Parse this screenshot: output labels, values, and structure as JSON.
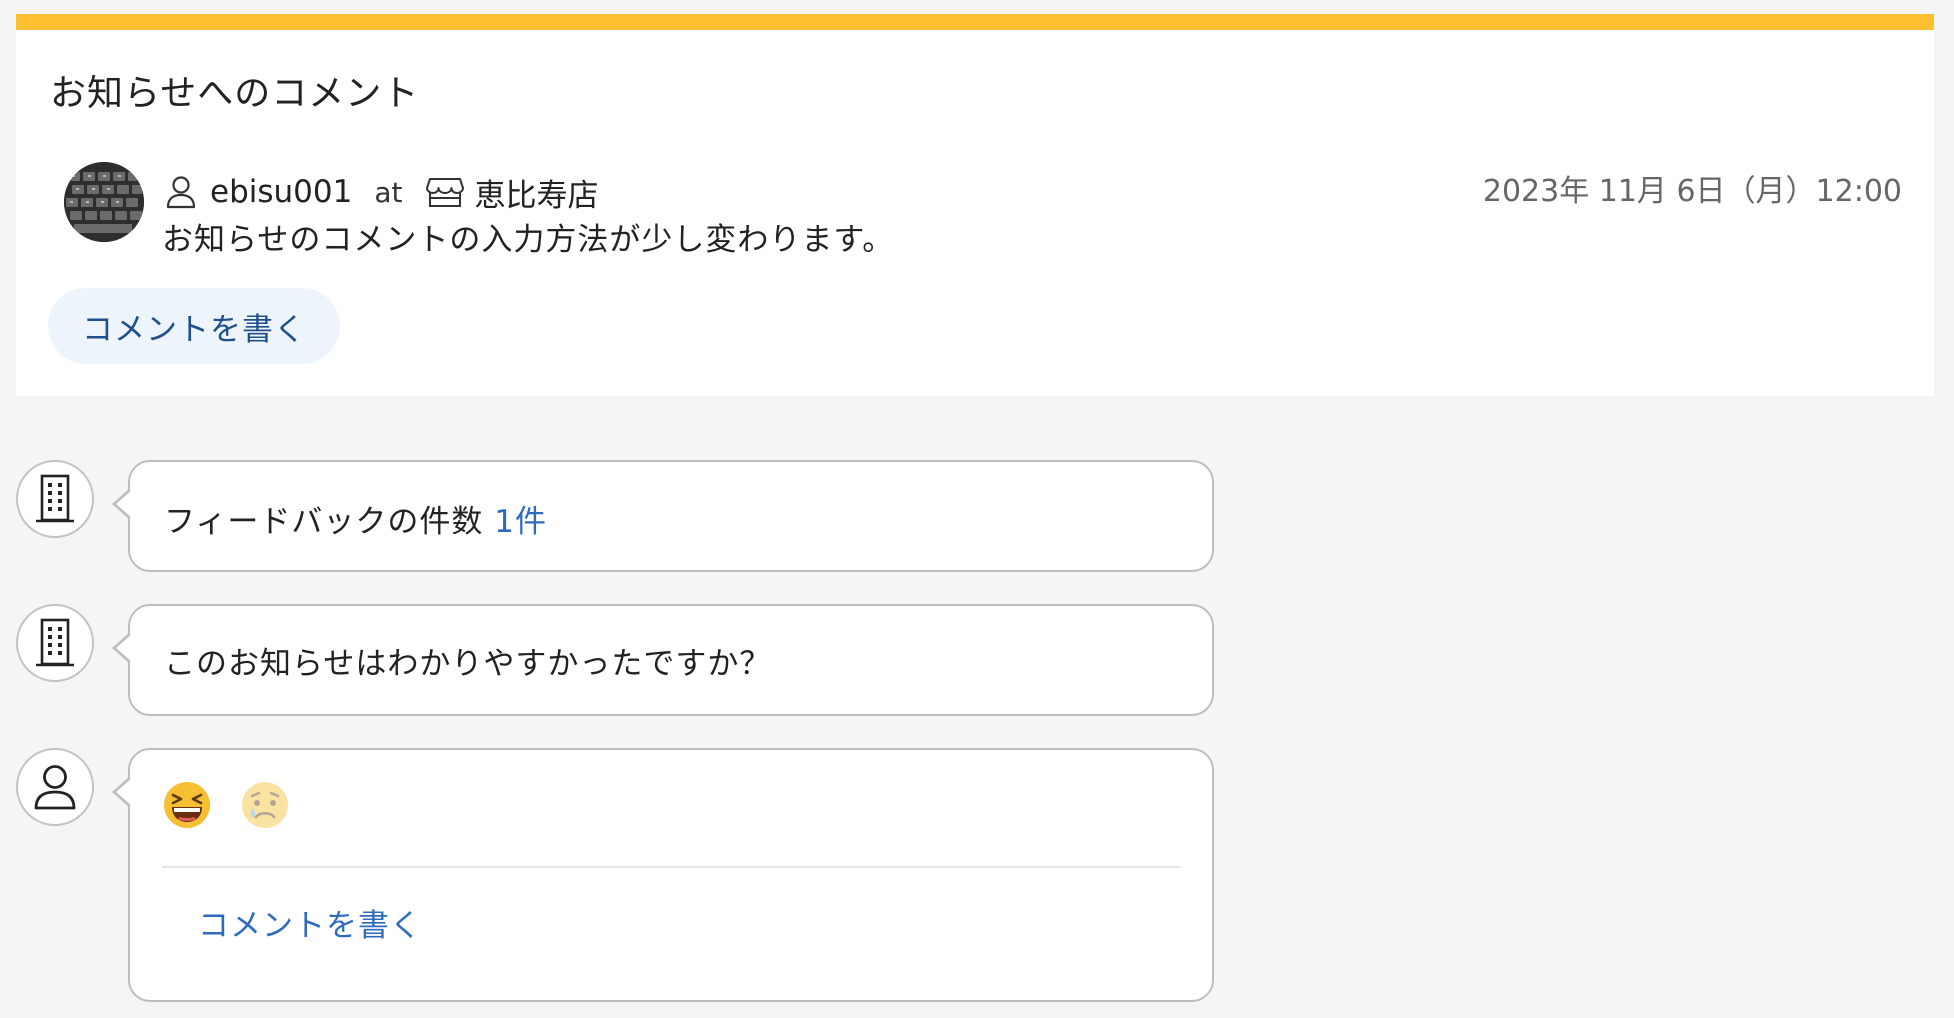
{
  "card": {
    "title": "お知らせへのコメント",
    "accent_color": "#fcbf2f"
  },
  "post": {
    "avatar_icon": "keyboard-photo-avatar",
    "username": "ebisu001",
    "at": "at",
    "store": "恵比寿店",
    "datetime": "2023年 11月 6日（月）12:00",
    "body": "お知らせのコメントの入力方法が少し変わります。",
    "comment_button_label": "コメントを書く"
  },
  "feed": {
    "feedback_prefix": "フィードバックの件数",
    "feedback_count": "1件",
    "question": "このお知らせはわかりやすかったですか？",
    "reactions": [
      {
        "icon": "laughing-emoji-icon"
      },
      {
        "icon": "sad-emoji-icon"
      }
    ],
    "comment_link_label": "コメントを書く",
    "link_color": "#2f6bbd"
  }
}
